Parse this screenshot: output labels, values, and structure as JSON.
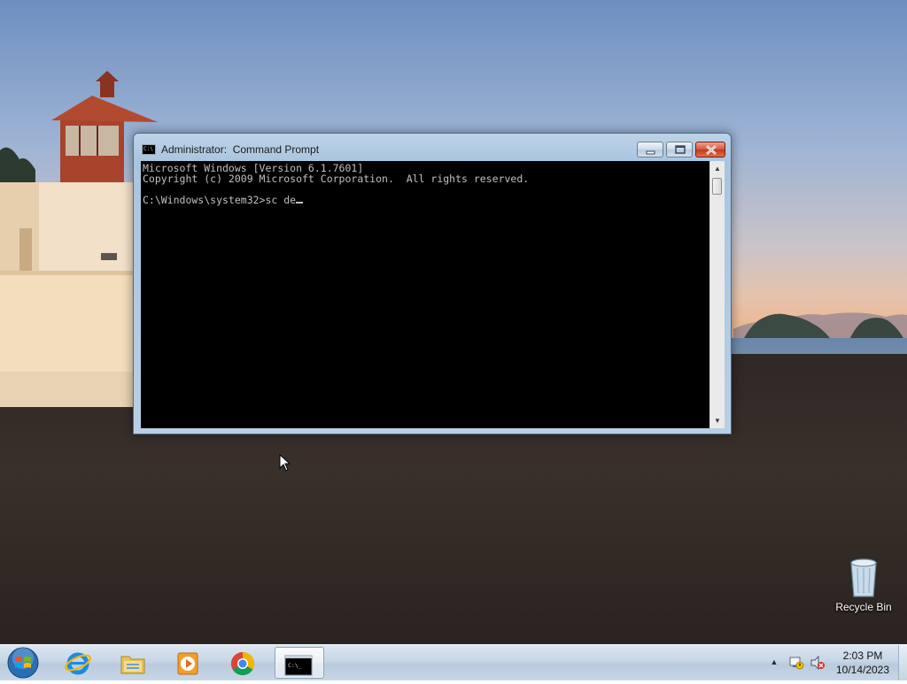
{
  "window": {
    "title": "Administrator:  Command Prompt",
    "console_lines": [
      "Microsoft Windows [Version 6.1.7601]",
      "Copyright (c) 2009 Microsoft Corporation.  All rights reserved.",
      "",
      "C:\\Windows\\system32>sc de"
    ],
    "title_icon_text": "C:\\"
  },
  "desktop": {
    "icons": [
      {
        "label": "Recycle Bin"
      }
    ]
  },
  "taskbar": {
    "clock_time": "2:03 PM",
    "clock_date": "10/14/2023",
    "pinned": [
      "internet-explorer-icon",
      "windows-explorer-icon",
      "media-player-icon",
      "chrome-icon",
      "command-prompt-icon"
    ],
    "active": "command-prompt-icon",
    "task_cmd_icon_text": "C:\\_"
  },
  "colors": {
    "console_bg": "#000000",
    "console_fg": "#c0c0c0",
    "close_button": "#c13a1d"
  }
}
